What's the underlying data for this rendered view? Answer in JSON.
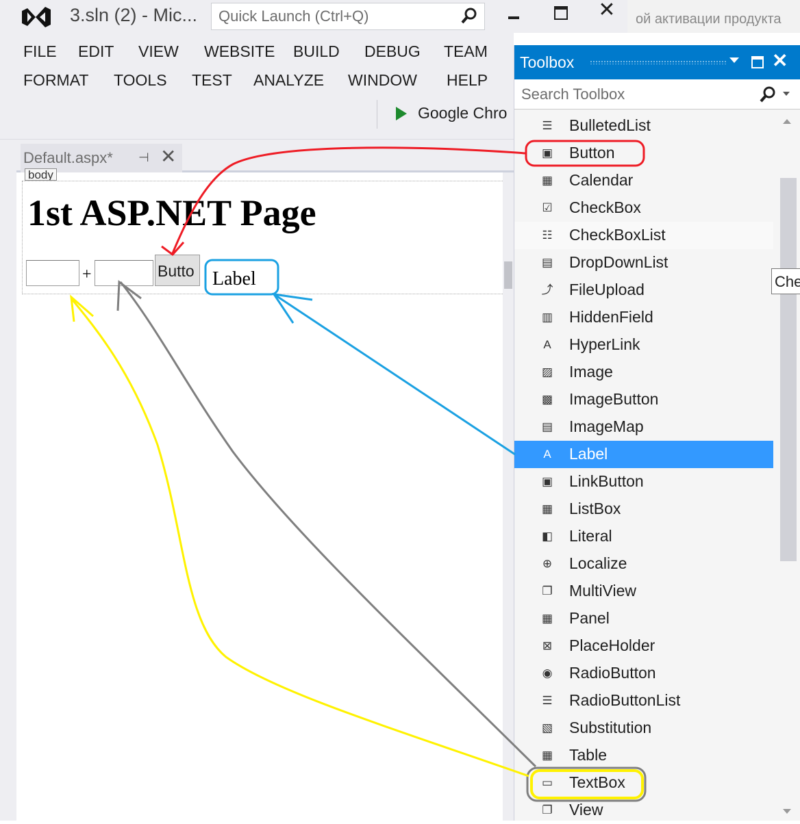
{
  "window": {
    "title": "3.sln (2) - Mic...",
    "quick_launch_placeholder": "Quick Launch (Ctrl+Q)",
    "background_text": "ой активации продукта"
  },
  "menu": {
    "row1": [
      "FILE",
      "EDIT",
      "VIEW",
      "WEBSITE",
      "BUILD",
      "DEBUG",
      "TEAM"
    ],
    "row2": [
      "FORMAT",
      "TOOLS",
      "TEST",
      "ANALYZE",
      "WINDOW",
      "HELP"
    ]
  },
  "toolbar": {
    "run_label": "Google Chro"
  },
  "document": {
    "tab_label": "Default.aspx*",
    "body_tag": "body",
    "heading": "1st ASP.NET Page",
    "plus": "+",
    "button_text": "Butto",
    "label_text": "Label"
  },
  "toolbox": {
    "title": "Toolbox",
    "search_placeholder": "Search Toolbox",
    "items": [
      {
        "label": "BulletedList",
        "icon": "bulleted-list-icon",
        "glyph": "☰"
      },
      {
        "label": "Button",
        "icon": "button-icon",
        "glyph": "▣"
      },
      {
        "label": "Calendar",
        "icon": "calendar-icon",
        "glyph": "▦"
      },
      {
        "label": "CheckBox",
        "icon": "checkbox-icon",
        "glyph": "☑"
      },
      {
        "label": "CheckBoxList",
        "icon": "checkbox-list-icon",
        "glyph": "☷"
      },
      {
        "label": "DropDownList",
        "icon": "dropdown-list-icon",
        "glyph": "▤"
      },
      {
        "label": "FileUpload",
        "icon": "file-upload-icon",
        "glyph": "⤴"
      },
      {
        "label": "HiddenField",
        "icon": "hidden-field-icon",
        "glyph": "▥"
      },
      {
        "label": "HyperLink",
        "icon": "hyperlink-icon",
        "glyph": "A"
      },
      {
        "label": "Image",
        "icon": "image-icon",
        "glyph": "▨"
      },
      {
        "label": "ImageButton",
        "icon": "image-button-icon",
        "glyph": "▩"
      },
      {
        "label": "ImageMap",
        "icon": "image-map-icon",
        "glyph": "▤"
      },
      {
        "label": "Label",
        "icon": "label-icon",
        "glyph": "A"
      },
      {
        "label": "LinkButton",
        "icon": "link-button-icon",
        "glyph": "▣"
      },
      {
        "label": "ListBox",
        "icon": "listbox-icon",
        "glyph": "▦"
      },
      {
        "label": "Literal",
        "icon": "literal-icon",
        "glyph": "◧"
      },
      {
        "label": "Localize",
        "icon": "localize-icon",
        "glyph": "⊕"
      },
      {
        "label": "MultiView",
        "icon": "multiview-icon",
        "glyph": "❐"
      },
      {
        "label": "Panel",
        "icon": "panel-icon",
        "glyph": "▦"
      },
      {
        "label": "PlaceHolder",
        "icon": "placeholder-icon",
        "glyph": "⊠"
      },
      {
        "label": "RadioButton",
        "icon": "radio-button-icon",
        "glyph": "◉"
      },
      {
        "label": "RadioButtonList",
        "icon": "radio-button-list-icon",
        "glyph": "☰"
      },
      {
        "label": "Substitution",
        "icon": "substitution-icon",
        "glyph": "▧"
      },
      {
        "label": "Table",
        "icon": "table-icon",
        "glyph": "▦"
      },
      {
        "label": "TextBox",
        "icon": "textbox-icon",
        "glyph": "▭"
      },
      {
        "label": "View",
        "icon": "view-icon",
        "glyph": "❐"
      }
    ],
    "selected": "Label",
    "hover": "CheckBoxList",
    "tooltip_partial": "Che"
  },
  "colors": {
    "accent": "#007acc",
    "selection": "#3399ff",
    "annotation_red": "#ee1c25",
    "annotation_blue": "#1ba1e2",
    "annotation_yellow": "#fff200",
    "annotation_gray": "#7f7f7f"
  }
}
